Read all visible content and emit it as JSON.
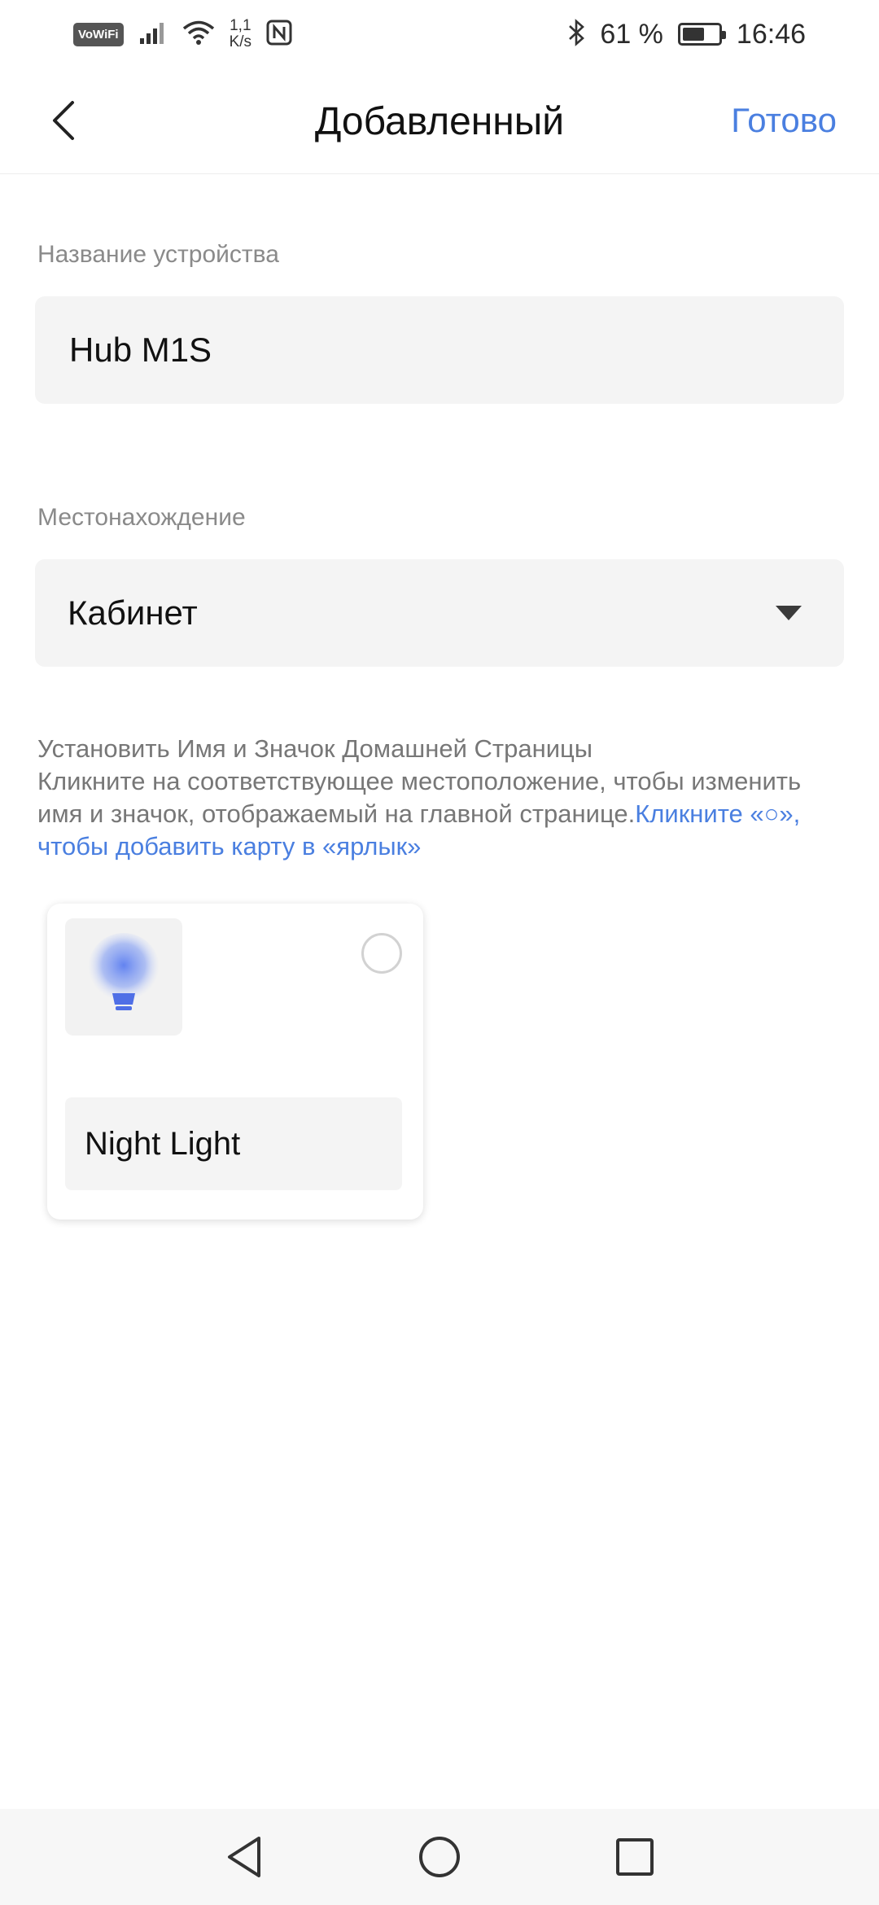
{
  "status_bar": {
    "vowifi": "VoWiFi",
    "speed_value": "1,1",
    "speed_unit": "K/s",
    "battery_percent": "61 %",
    "battery_level": 0.61,
    "time": "16:46"
  },
  "header": {
    "title": "Добавленный",
    "done_label": "Готово"
  },
  "device_name": {
    "label": "Название устройства",
    "value": "Hub M1S"
  },
  "location": {
    "label": "Местонахождение",
    "value": "Кабинет"
  },
  "info": {
    "title": "Установить Имя и Значок Домашней Страницы",
    "description": "Кликните на соответствующее местоположение, чтобы изменить имя и значок, отображаемый на главной странице.",
    "link": "Кликните «○», чтобы добавить карту в «ярлык»"
  },
  "card": {
    "icon": "light-bulb-icon",
    "name": "Night Light",
    "selected": false
  },
  "colors": {
    "accent": "#4a7fe0",
    "field_bg": "#f4f4f4",
    "label_gray": "#8a8a8a"
  }
}
